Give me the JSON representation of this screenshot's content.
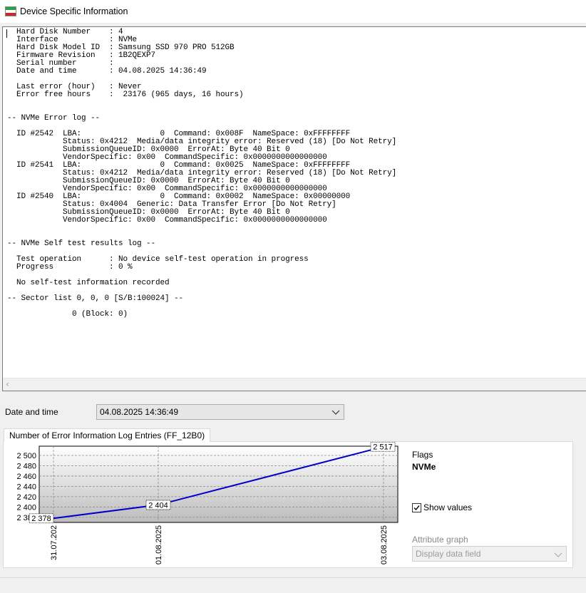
{
  "window": {
    "title": "Device Specific Information",
    "icon": "app-flag-icon",
    "icon_colors": [
      "#2e9e44",
      "#ffffff",
      "#c62b2b"
    ]
  },
  "log": {
    "text": "  Hard Disk Number    : 4\n  Interface           : NVMe\n  Hard Disk Model ID  : Samsung SSD 970 PRO 512GB\n  Firmware Revision   : 1B2QEXP7\n  Serial number       :\n  Date and time       : 04.08.2025 14:36:49\n\n  Last error (hour)   : Never\n  Error free hours    :  23176 (965 days, 16 hours)\n\n\n-- NVMe Error log --\n\n  ID #2542  LBA:                 0  Command: 0x008F  NameSpace: 0xFFFFFFFF\n            Status: 0x4212  Media/data integrity error: Reserved (18) [Do Not Retry]\n            SubmissionQueueID: 0x0000  ErrorAt: Byte 40 Bit 0\n            VendorSpecific: 0x00  CommandSpecific: 0x0000000000000000\n  ID #2541  LBA:                 0  Command: 0x0025  NameSpace: 0xFFFFFFFF\n            Status: 0x4212  Media/data integrity error: Reserved (18) [Do Not Retry]\n            SubmissionQueueID: 0x0000  ErrorAt: Byte 40 Bit 0\n            VendorSpecific: 0x00  CommandSpecific: 0x0000000000000000\n  ID #2540  LBA:                 0  Command: 0x0002  NameSpace: 0x00000000\n            Status: 0x4004  Generic: Data Transfer Error [Do Not Retry]\n            SubmissionQueueID: 0x0000  ErrorAt: Byte 40 Bit 0\n            VendorSpecific: 0x00  CommandSpecific: 0x0000000000000000\n\n\n-- NVMe Self test results log --\n\n  Test operation      : No device self-test operation in progress\n  Progress            : 0 %\n\n  No self-test information recorded\n\n-- Sector list 0, 0, 0 [S/B:100024] --\n\n              0 (Block: 0)"
  },
  "date_time": {
    "label": "Date and time",
    "selected": "04.08.2025 14:36:49"
  },
  "tab": {
    "label": "Number of Error Information Log Entries (FF_12B0)"
  },
  "side": {
    "flags_label": "Flags",
    "flags_value": "NVMe",
    "show_values_label": "Show values",
    "show_values_checked": true,
    "attr_graph_label": "Attribute graph",
    "attr_graph_value": "Display data field"
  },
  "chart_data": {
    "type": "line",
    "x": [
      "31.07.2025",
      "01.08.2025",
      "03.08.2025"
    ],
    "x_tick_labels": [
      "31.07.202",
      "01.08.2025",
      "03.08.2025"
    ],
    "values": [
      2378,
      2404,
      2517
    ],
    "data_labels": [
      "2 378",
      "2 404",
      "2 517"
    ],
    "y_ticks": [
      2380,
      2400,
      2420,
      2440,
      2460,
      2480,
      2500
    ],
    "y_tick_labels": [
      "2 380",
      "2 400",
      "2 420",
      "2 440",
      "2 460",
      "2 480",
      "2 500"
    ],
    "ylim": [
      2370,
      2518
    ],
    "grid": true,
    "line_color": "#0000c8",
    "plot_gradient": [
      "#ffffff",
      "#bcbcbc"
    ]
  }
}
